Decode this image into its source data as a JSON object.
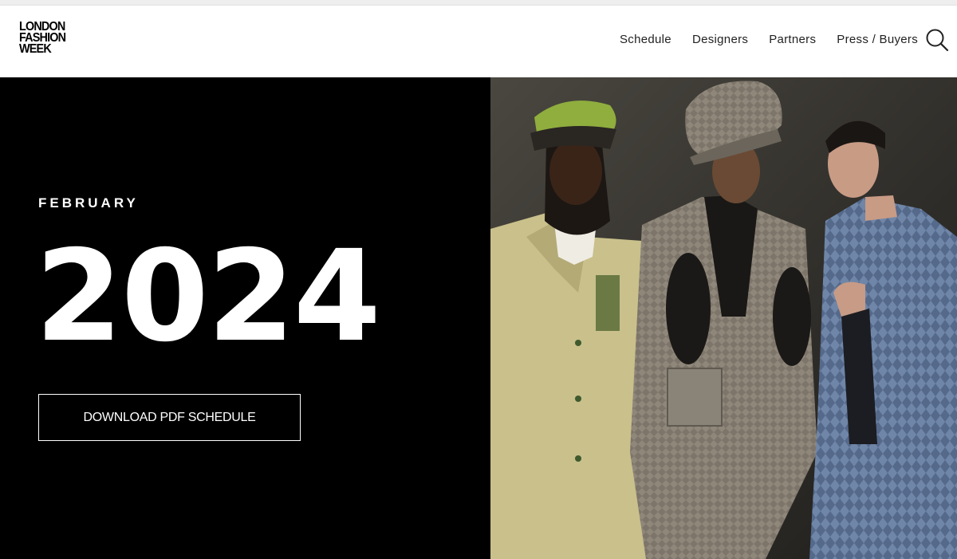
{
  "brand": {
    "line1": "LONDON",
    "line2": "FASHION",
    "line3": "WEEK"
  },
  "nav": {
    "items": [
      "Schedule",
      "Designers",
      "Partners",
      "Press / Buyers"
    ],
    "search_icon": "search-icon"
  },
  "hero": {
    "month": "FEBRUARY",
    "year": "2024",
    "button_label": "DOWNLOAD PDF SCHEDULE",
    "image": "three-models-backstage-photo"
  },
  "colors": {
    "background": "#000000",
    "text": "#ffffff",
    "header_bg": "#ffffff",
    "nav_text": "#222222"
  }
}
